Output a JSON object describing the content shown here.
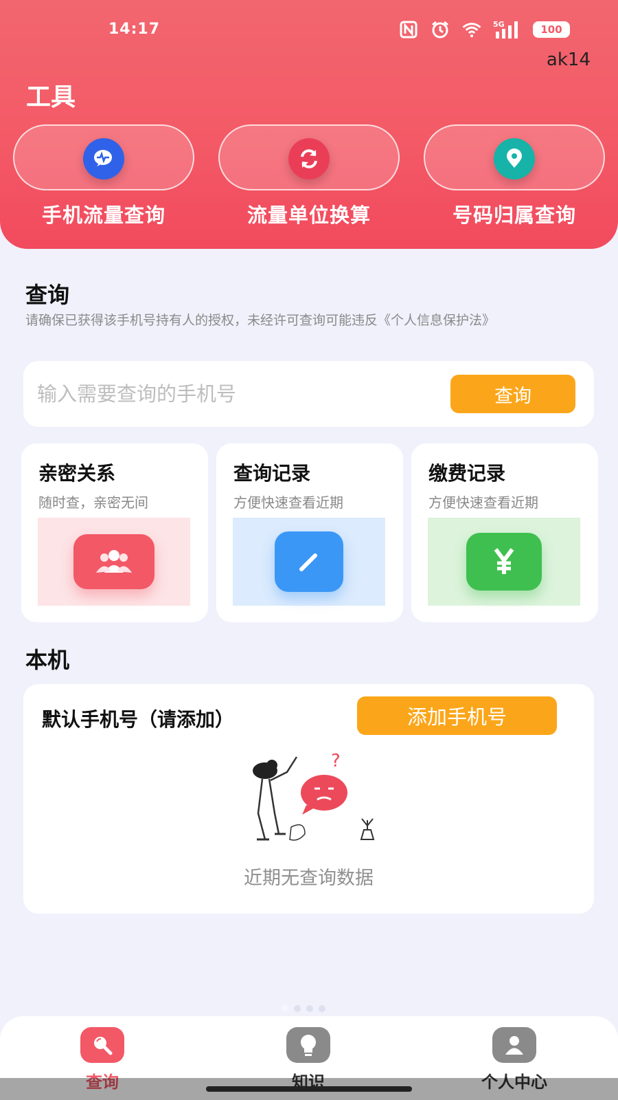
{
  "status_bar": {
    "time": "14:17",
    "battery": "100",
    "network": "5G"
  },
  "user_tag": "ak14",
  "tools": {
    "title": "工具",
    "items": [
      {
        "label": "手机流量查询",
        "icon": "chat-pulse-icon",
        "color": "#2f62e8"
      },
      {
        "label": "流量单位换算",
        "icon": "refresh-icon",
        "color": "#ea3e57"
      },
      {
        "label": "号码归属查询",
        "icon": "location-pin-icon",
        "color": "#17b3a9"
      }
    ]
  },
  "query": {
    "title": "查询",
    "notice": "请确保已获得该手机号持有人的授权，未经许可查询可能违反《个人信息保护法》",
    "input_placeholder": "输入需要查询的手机号",
    "input_value": "",
    "button": "查询"
  },
  "features": [
    {
      "title": "亲密关系",
      "subtitle": "随时查，亲密无间",
      "icon": "people-icon",
      "bg": "#fde4e6",
      "color": "#f25866"
    },
    {
      "title": "查询记录",
      "subtitle": "方便快速查看近期",
      "icon": "edit-icon",
      "bg": "#dcebfd",
      "color": "#3b97f6"
    },
    {
      "title": "缴费记录",
      "subtitle": "方便快速查看近期",
      "icon": "yen-icon",
      "bg": "#ddf3dc",
      "color": "#3fbf4f"
    }
  ],
  "local": {
    "title": "本机",
    "label": "默认手机号（请添加）",
    "add_button": "添加手机号",
    "empty_text": "近期无查询数据"
  },
  "nav": [
    {
      "label": "查询",
      "icon": "search-icon",
      "active": true,
      "color": "#f25866"
    },
    {
      "label": "知识",
      "icon": "lightbulb-icon",
      "active": false,
      "color": "#555"
    },
    {
      "label": "个人中心",
      "icon": "person-icon",
      "active": false,
      "color": "#555"
    }
  ]
}
